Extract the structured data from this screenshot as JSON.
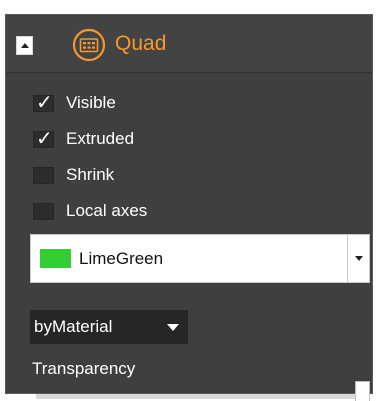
{
  "header": {
    "title": "Quad",
    "icon": "quad-icon",
    "title_color": "#f39a2f"
  },
  "options": [
    {
      "key": "visible",
      "label": "Visible",
      "checked": true
    },
    {
      "key": "extruded",
      "label": "Extruded",
      "checked": true
    },
    {
      "key": "shrink",
      "label": "Shrink",
      "checked": false
    },
    {
      "key": "local-axes",
      "label": "Local axes",
      "checked": false
    }
  ],
  "color_select": {
    "value": "LimeGreen",
    "swatch_color": "#32cd32"
  },
  "mode_select": {
    "value": "byMaterial"
  },
  "transparency": {
    "label": "Transparency",
    "value_fraction": 1.0
  }
}
